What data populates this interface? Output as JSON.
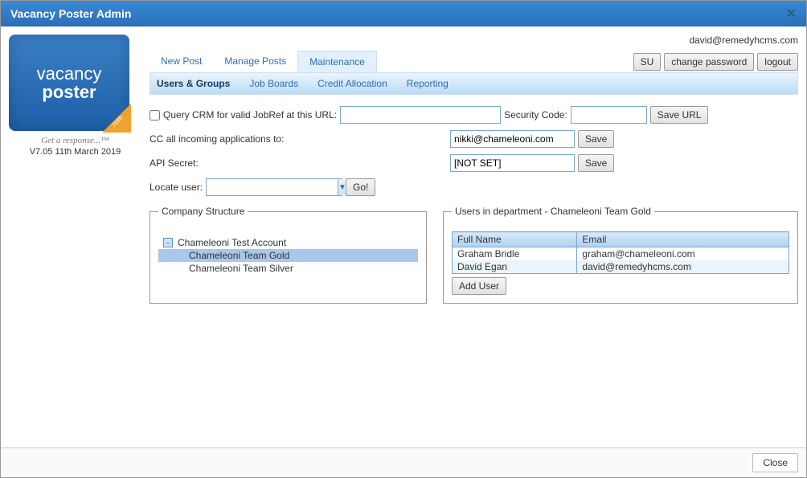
{
  "window": {
    "title": "Vacancy Poster Admin"
  },
  "logo": {
    "line1": "vacancy",
    "line2": "poster",
    "badge": ".com"
  },
  "tagline": "Get a response...™",
  "version": "V7.05 11th March 2019",
  "user_email": "david@remedyhcms.com",
  "header_buttons": {
    "su": "SU",
    "change_password": "change password",
    "logout": "logout"
  },
  "maintabs": {
    "new_post": "New Post",
    "manage_posts": "Manage Posts",
    "maintenance": "Maintenance"
  },
  "subtabs": {
    "users_groups": "Users & Groups",
    "job_boards": "Job Boards",
    "credit_allocation": "Credit Allocation",
    "reporting": "Reporting"
  },
  "crm": {
    "checkbox_label": "Query CRM for valid JobRef at this URL:",
    "url_value": "",
    "security_label": "Security Code:",
    "security_value": "",
    "save_url": "Save URL"
  },
  "cc": {
    "label": "CC all incoming applications to:",
    "value": "nikki@chameleoni.com",
    "save": "Save"
  },
  "api": {
    "label": "API Secret:",
    "value": "[NOT SET]",
    "save": "Save"
  },
  "locate": {
    "label": "Locate user:",
    "value": "",
    "go": "Go!"
  },
  "company_structure": {
    "legend": "Company Structure",
    "root": "Chameleoni Test Account",
    "children": [
      "Chameleoni Team Gold",
      "Chameleoni Team Silver"
    ],
    "selected": "Chameleoni Team Gold"
  },
  "users_panel": {
    "legend": "Users in department - Chameleoni Team Gold",
    "headers": {
      "name": "Full Name",
      "email": "Email"
    },
    "rows": [
      {
        "name": "Graham Bridle",
        "email": "graham@chameleoni.com"
      },
      {
        "name": "David Egan",
        "email": "david@remedyhcms.com"
      }
    ],
    "add_user": "Add User"
  },
  "footer": {
    "close": "Close"
  }
}
